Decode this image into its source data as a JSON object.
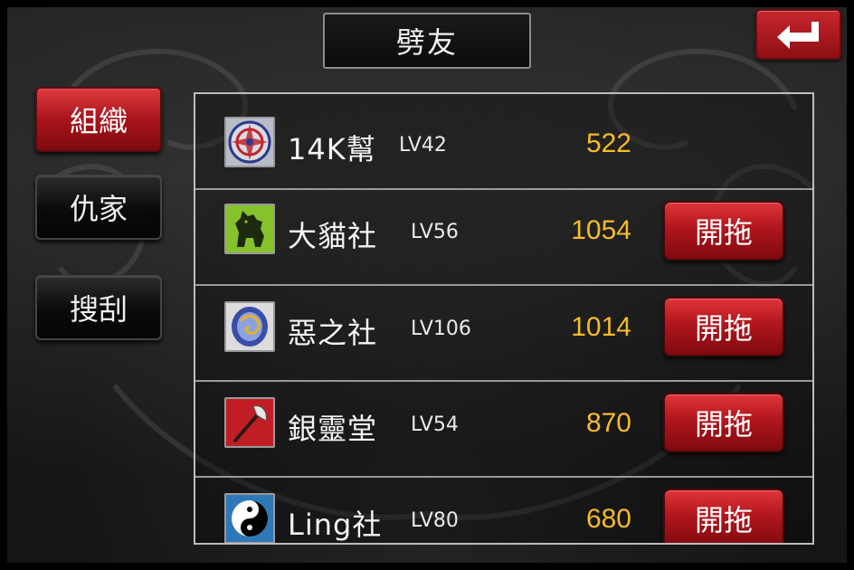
{
  "header": {
    "title": "劈友",
    "back_icon": "return-arrow-icon"
  },
  "sidebar": {
    "items": [
      {
        "label": "組織",
        "active": true
      },
      {
        "label": "仇家",
        "active": false
      },
      {
        "label": "搜刮",
        "active": false
      }
    ]
  },
  "gangs": [
    {
      "name": "14K幫",
      "level": "LV42",
      "score": "522",
      "action": "",
      "emblem": "compass-seal-emblem-icon"
    },
    {
      "name": "大貓社",
      "level": "LV56",
      "score": "1054",
      "action": "開拖",
      "emblem": "wolf-emblem-icon"
    },
    {
      "name": "惡之社",
      "level": "LV106",
      "score": "1014",
      "action": "開拖",
      "emblem": "dragon-medallion-emblem-icon"
    },
    {
      "name": "銀靈堂",
      "level": "LV54",
      "score": "870",
      "action": "開拖",
      "emblem": "axe-emblem-icon"
    },
    {
      "name": "Ling社",
      "level": "LV80",
      "score": "680",
      "action": "開拖",
      "emblem": "yin-yang-emblem-icon"
    }
  ],
  "colors": {
    "accent_red": "#b1161c",
    "score_gold": "#f5bb2a",
    "frame_gray": "#bdbdbd"
  }
}
